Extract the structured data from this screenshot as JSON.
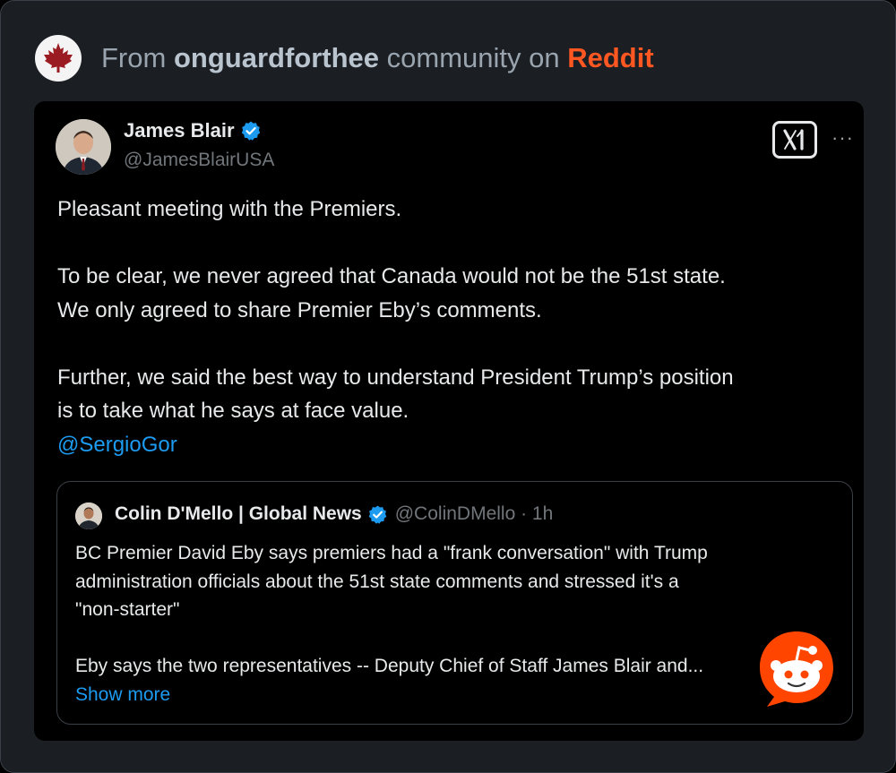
{
  "header": {
    "prefix": "From",
    "community": "onguardforthee",
    "middle": "community on",
    "site": "Reddit",
    "avatar_icon": "maple-leaf-icon"
  },
  "tweet": {
    "author_name": "James Blair",
    "author_handle": "@JamesBlairUSA",
    "logo": "x-logo-icon",
    "more": "···",
    "lines": {
      "l1": "Pleasant meeting with the Premiers.",
      "l2": "To be clear, we never agreed that Canada would not be the 51st state.",
      "l3": "We only agreed to share Premier Eby’s comments.",
      "l4": "Further, we said the best way to understand President Trump’s position",
      "l5": "is to take what he says at face value.",
      "mention": "@SergioGor"
    }
  },
  "quote": {
    "author_name": "Colin D'Mello | Global News",
    "handle_time": "@ColinDMello · 1h",
    "lines": {
      "l1": "BC Premier David Eby says premiers had a \"frank conversation\" with Trump",
      "l2": "administration officials about the 51st state comments and stressed it's a",
      "l3": "\"non-starter\"",
      "l4": "Eby says the two representatives -- Deputy Chief of Staff James Blair and..."
    },
    "show_more": "Show more"
  },
  "colors": {
    "reddit_orange": "#ff5722",
    "link_blue": "#1d9bf0",
    "verified_blue": "#1d9bf0"
  }
}
